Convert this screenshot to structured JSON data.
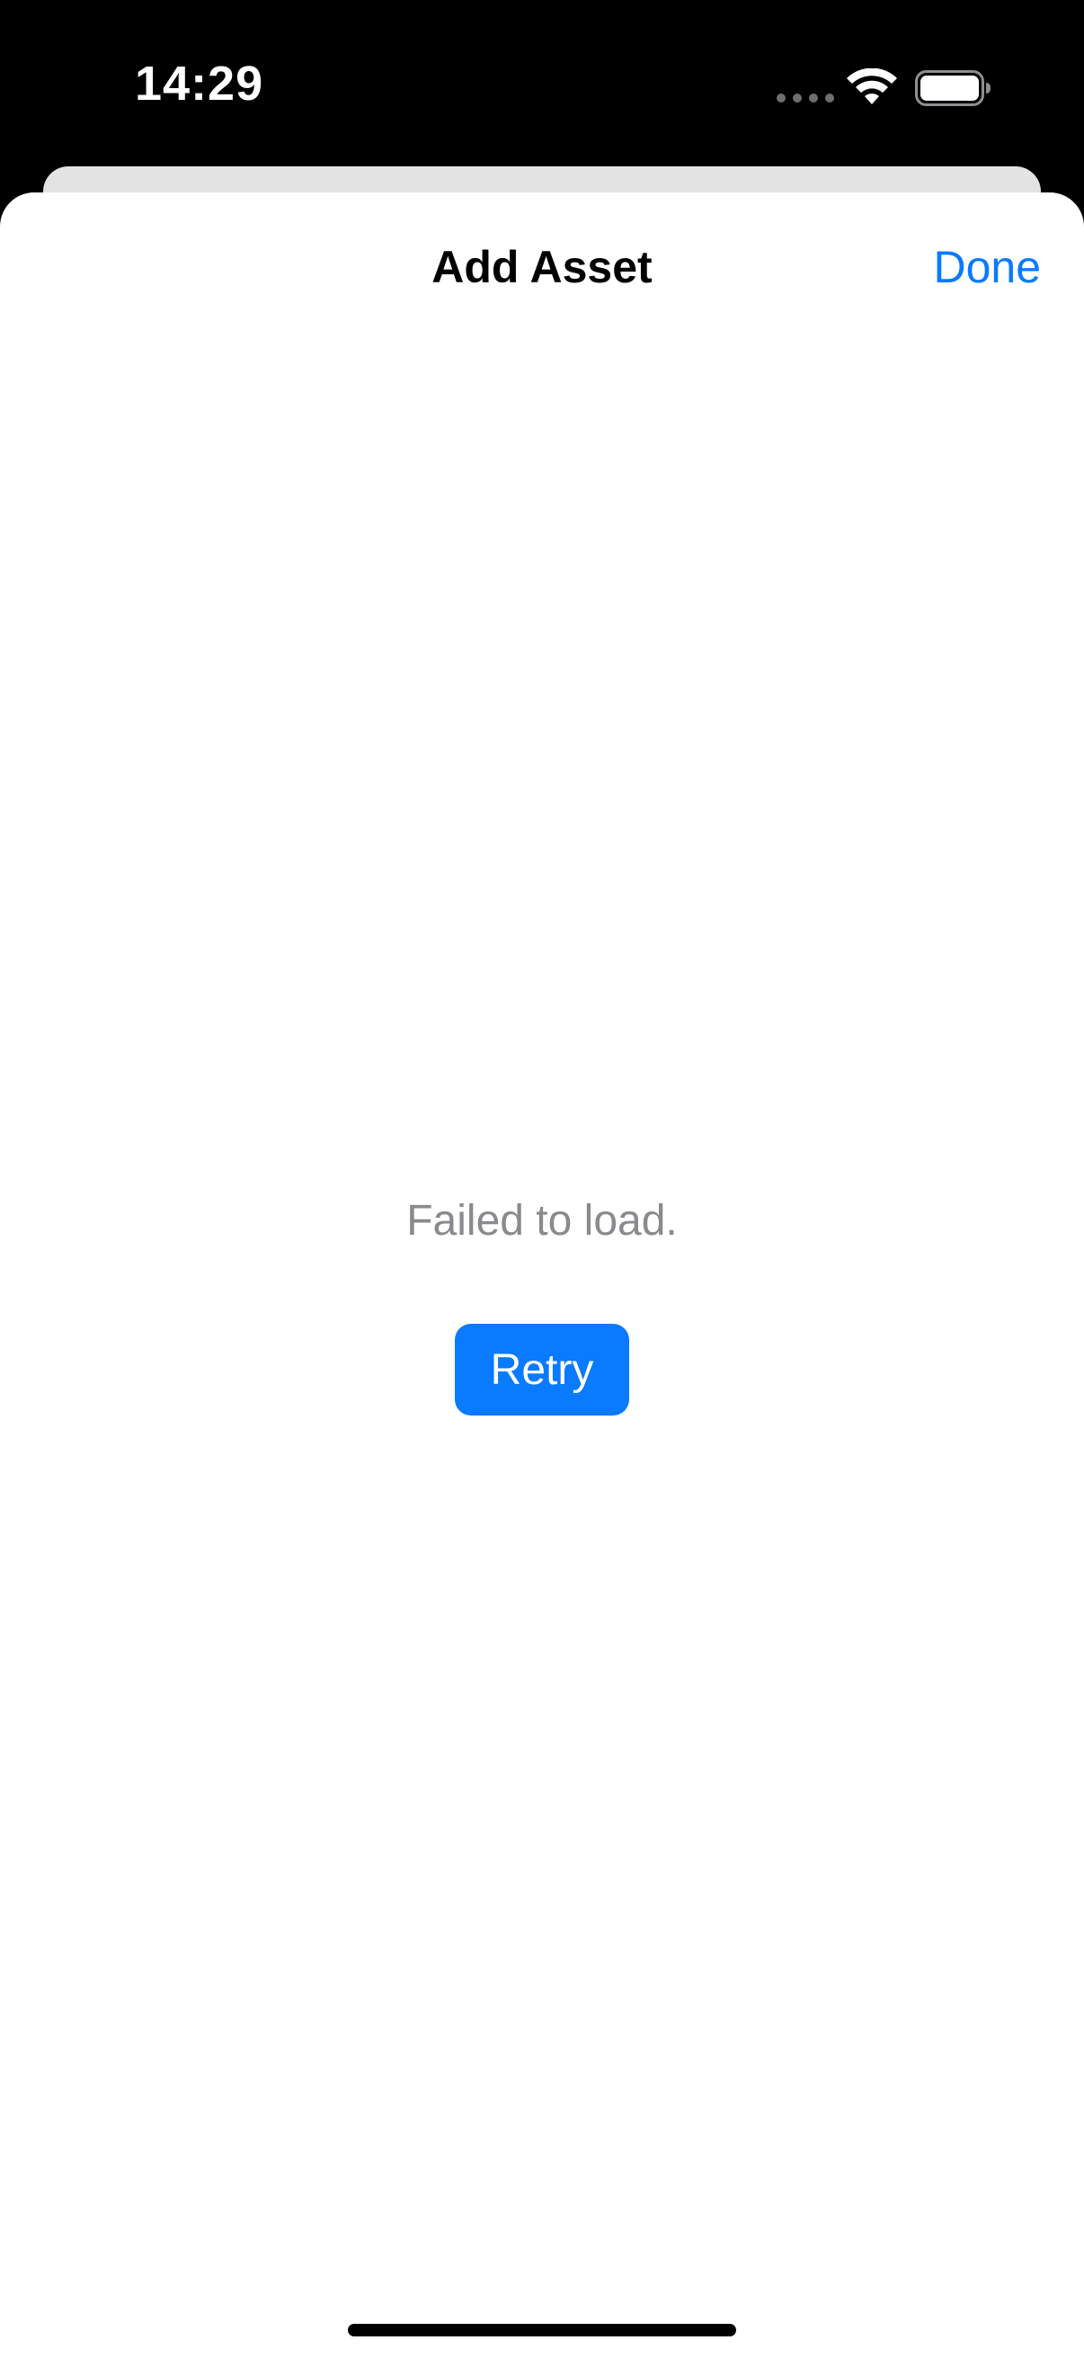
{
  "status_bar": {
    "time": "14:29",
    "icons": [
      "cellular-signal-icon",
      "wifi-icon",
      "battery-icon"
    ]
  },
  "sheet": {
    "title": "Add Asset",
    "done_label": "Done"
  },
  "content": {
    "error_message": "Failed to load.",
    "retry_label": "Retry"
  },
  "colors": {
    "accent": "#0a7aff",
    "secondary_text": "#8a8a8e",
    "background": "#ffffff"
  }
}
